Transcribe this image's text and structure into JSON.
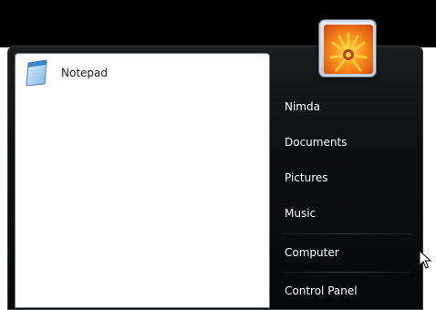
{
  "start_menu": {
    "pinned_program": {
      "label": "Notepad",
      "icon": "notepad-icon"
    },
    "user_picture": {
      "icon": "flower-user-picture"
    },
    "right_items": [
      {
        "label": "Nimda"
      },
      {
        "label": "Documents"
      },
      {
        "label": "Pictures"
      },
      {
        "label": "Music"
      },
      {
        "label": "Computer"
      },
      {
        "label": "Control Panel"
      }
    ]
  },
  "colors": {
    "menu_background": "#0e0f11",
    "left_pane": "#ffffff",
    "right_text": "#ffffff"
  }
}
